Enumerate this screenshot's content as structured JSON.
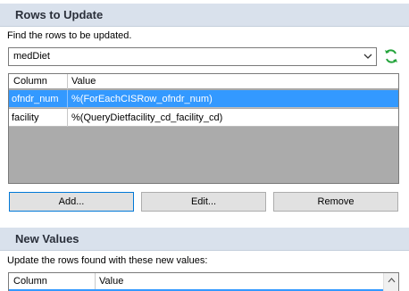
{
  "rows_to_update": {
    "title": "Rows to Update",
    "instruction": "Find the rows to be updated.",
    "table_select": {
      "value": "medDiet"
    },
    "grid": {
      "columns": [
        "Column",
        "Value"
      ],
      "rows": [
        {
          "column": "ofndr_num",
          "value": "%(ForEachCISRow_ofndr_num)",
          "selected": true
        },
        {
          "column": "facility",
          "value": "%(QueryDietfacility_cd_facility_cd)",
          "selected": false
        }
      ]
    },
    "buttons": {
      "add": "Add...",
      "edit": "Edit...",
      "remove": "Remove"
    }
  },
  "new_values": {
    "title": "New Values",
    "instruction": "Update the rows found with these new values:",
    "grid": {
      "columns": [
        "Column",
        "Value"
      ]
    }
  },
  "colors": {
    "header_bg": "#d9e1ec",
    "selection": "#3399ff",
    "refresh_icon": "#22a33a"
  }
}
